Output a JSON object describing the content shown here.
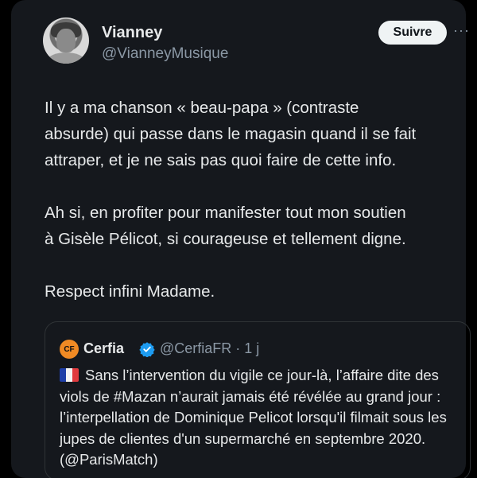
{
  "author": {
    "name": "Vianney",
    "handle": "@VianneyMusique"
  },
  "follow_label": "Suivre",
  "more_label": "···",
  "tweet": {
    "text": "Il y a ma chanson « beau-papa » (contraste\nabsurde) qui passe dans le magasin quand il se fait\nattraper, et je ne sais pas quoi faire de cette info.\n\nAh si, en profiter pour manifester tout mon soutien\nà Gisèle Pélicot, si courageuse et tellement digne.\n\nRespect infini Madame."
  },
  "quote": {
    "logo_text": "CF",
    "name": "Cerfia",
    "handle_time": "@CerfiaFR · 1 j",
    "text": "Sans l’intervention du vigile ce jour-là, l’affaire dite des viols de #Mazan n’aurait jamais été révélée au grand jour : l’interpellation de Dominique Pelicot lorsqu'il filmait sous les jupes de clientes d'un supermarché en septembre 2020. (@ParisMatch)"
  },
  "colors": {
    "background": "#15181d",
    "text": "#e7e9ea",
    "secondary": "#8b98a5",
    "verified": "#1d9bf0",
    "logo": "#f08a24"
  },
  "icons": {
    "verified": "verified-badge-icon",
    "flag": "france-flag-icon",
    "more": "more-icon"
  }
}
